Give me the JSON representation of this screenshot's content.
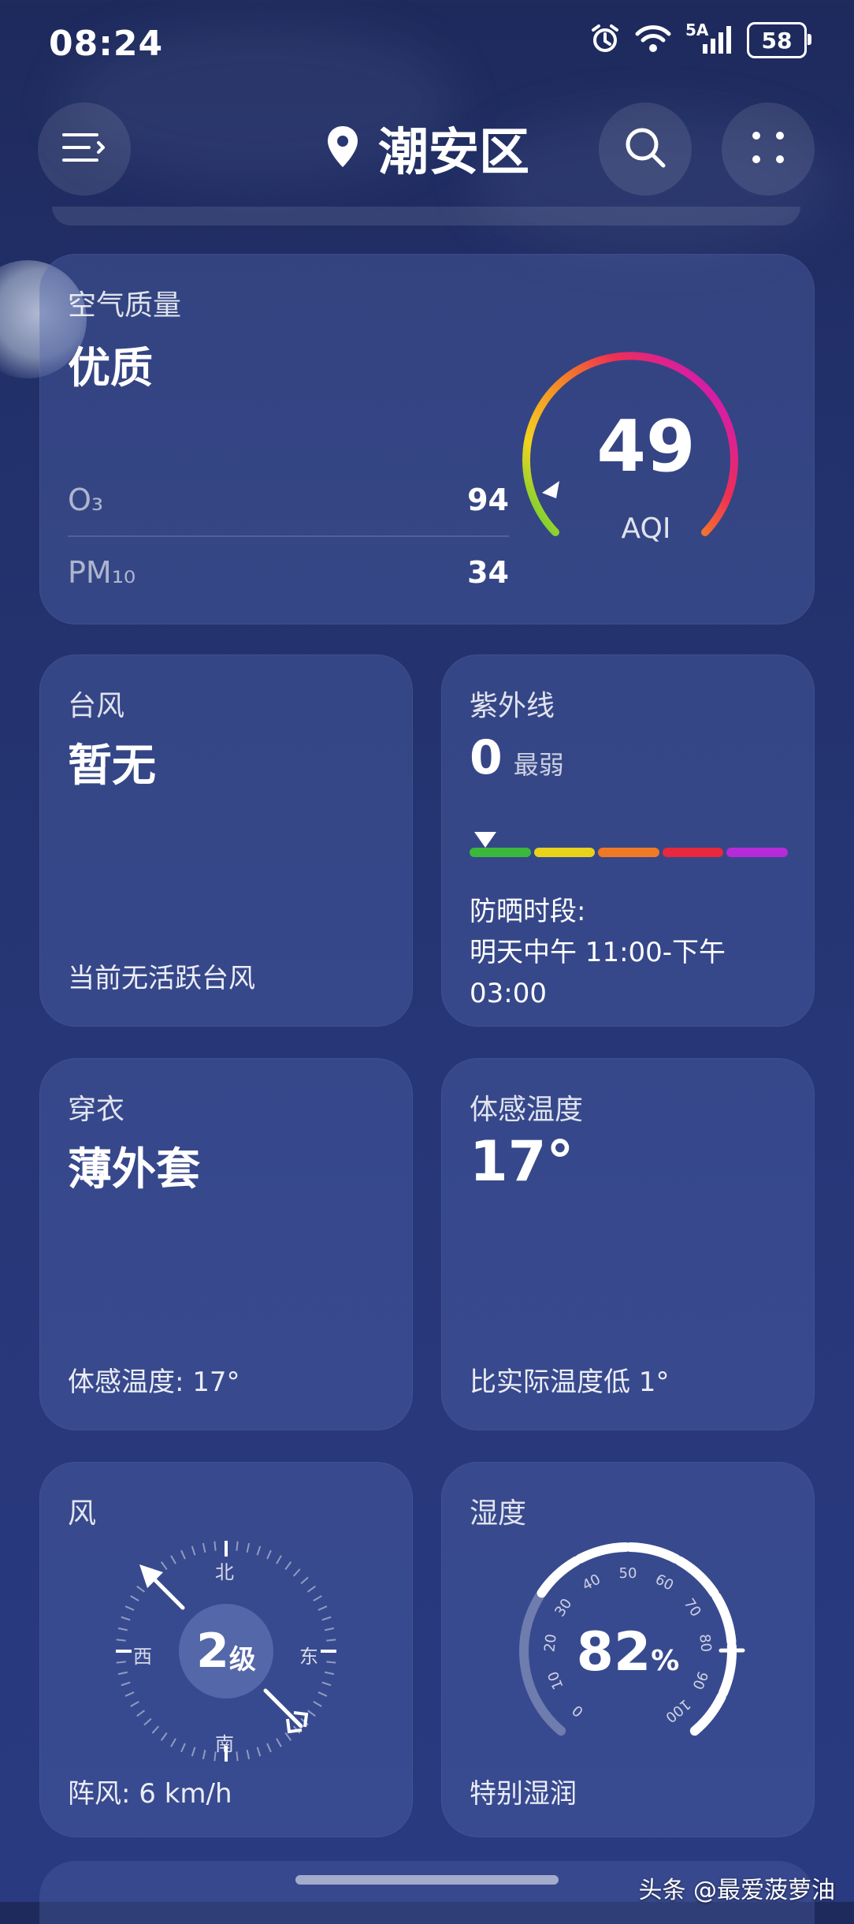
{
  "status_bar": {
    "time": "08:24",
    "network": "5A",
    "battery": "58"
  },
  "header": {
    "city": "潮安区"
  },
  "air_quality": {
    "title": "空气质量",
    "level": "优质",
    "aqi": "49",
    "aqi_label": "AQI",
    "rows": [
      {
        "label": "O₃",
        "value": "94"
      },
      {
        "label": "PM₁₀",
        "value": "34"
      }
    ]
  },
  "typhoon": {
    "title": "台风",
    "value": "暂无",
    "note": "当前无活跃台风"
  },
  "uv": {
    "title": "紫外线",
    "value": "0",
    "level": "最弱",
    "level_fraction": 0.05,
    "protect_label": "防晒时段:",
    "protect_time_1": "明天中午 11:00-下午",
    "protect_time_2": "03:00",
    "scale_colors": [
      "#3bb83b",
      "#e8d21c",
      "#ee7a25",
      "#e8283c",
      "#b62bd9"
    ]
  },
  "clothing": {
    "title": "穿衣",
    "value": "薄外套",
    "note": "体感温度: 17°"
  },
  "feels_like": {
    "title": "体感温度",
    "value": "17°",
    "note": "比实际温度低 1°"
  },
  "wind": {
    "title": "风",
    "level": "2",
    "unit": "级",
    "directions": {
      "north": "北",
      "south": "南",
      "east": "东",
      "west": "西"
    },
    "gust": "阵风: 6 km/h"
  },
  "humidity": {
    "title": "湿度",
    "value": "82",
    "unit": "%",
    "ticks": [
      "0",
      "10",
      "20",
      "30",
      "40",
      "50",
      "60",
      "70",
      "80",
      "90",
      "100"
    ],
    "note": "特别湿润"
  },
  "watermark": "头条 @最爱菠萝油"
}
